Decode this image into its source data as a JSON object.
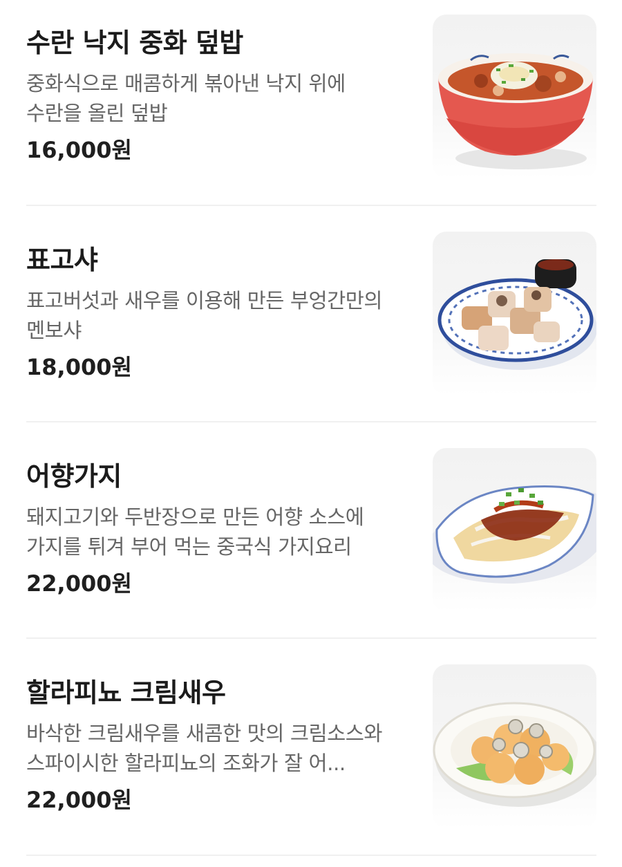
{
  "currency_suffix": "원",
  "menu": {
    "items": [
      {
        "name": "수란 낙지 중화 덮밥",
        "description": "중화식으로 매콤하게 볶아낸 낙지 위에 수란을 올린 덮밥",
        "price": "16,000원",
        "image_icon": "bowl-dish-photo"
      },
      {
        "name": "표고샤",
        "description": "표고버섯과 새우를 이용해 만든 부엉간만의 멘보샤",
        "price": "18,000원",
        "image_icon": "plate-dish-photo"
      },
      {
        "name": "어향가지",
        "description": "돼지고기와 두반장으로 만든 어향 소스에 가지를 튀겨 부어 먹는 중국식 가지요리",
        "price": "22,000원",
        "image_icon": "oval-plate-dish-photo"
      },
      {
        "name": "할라피뇨 크림새우",
        "description": "바삭한 크림새우를 새콤한 맛의 크림소스와 스파이시한 할라피뇨의 조화가 잘 어...",
        "price": "22,000원",
        "image_icon": "round-plate-dish-photo"
      }
    ]
  }
}
